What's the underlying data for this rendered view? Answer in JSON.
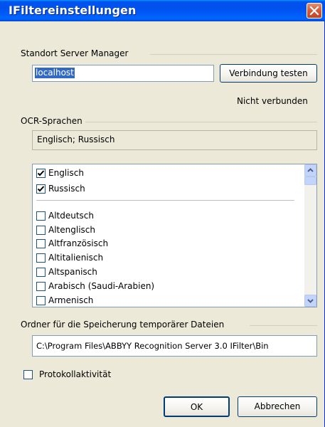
{
  "window": {
    "title": "IFiltereinstellungen"
  },
  "server_manager": {
    "group_label": "Standort Server Manager",
    "host_value": "localhost",
    "test_button_label": "Verbindung testen",
    "status_text": "Nicht verbunden"
  },
  "ocr": {
    "group_label": "OCR-Sprachen",
    "selected_summary": "Englisch; Russisch",
    "checked_languages": [
      {
        "label": "Englisch",
        "checked": true
      },
      {
        "label": "Russisch",
        "checked": true
      }
    ],
    "languages": [
      {
        "label": "Altdeutsch",
        "checked": false
      },
      {
        "label": "Altenglisch",
        "checked": false
      },
      {
        "label": "Altfranzösisch",
        "checked": false
      },
      {
        "label": "Altitalienisch",
        "checked": false
      },
      {
        "label": "Altspanisch",
        "checked": false
      },
      {
        "label": "Arabisch (Saudi-Arabien)",
        "checked": false
      },
      {
        "label": "Armenisch",
        "checked": false
      }
    ]
  },
  "temp_folder": {
    "group_label": "Ordner für die Speicherung temporärer Dateien",
    "path_value": "C:\\Program Files\\ABBYY Recognition Server 3.0 IFilter\\Bin"
  },
  "logging": {
    "label": "Protokollaktivität",
    "checked": false
  },
  "footer": {
    "ok_label": "OK",
    "cancel_label": "Abbrechen"
  }
}
